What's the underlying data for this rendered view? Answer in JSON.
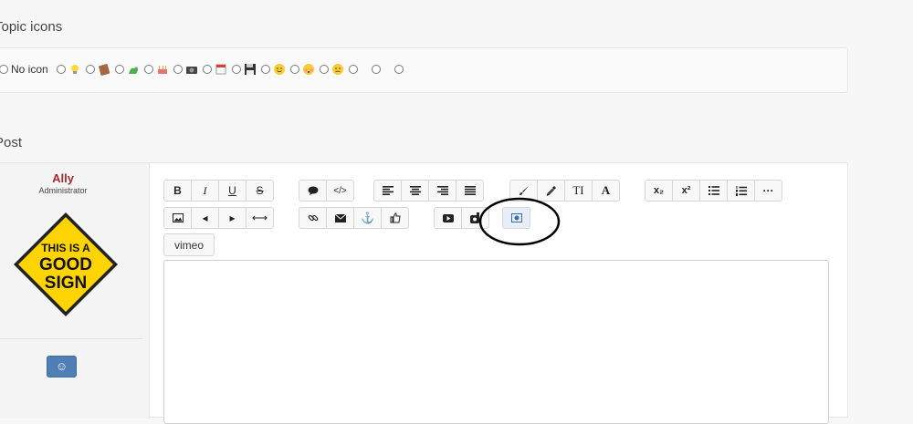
{
  "topic_icons": {
    "title": "Topic icons",
    "no_icon_label": "No icon",
    "options": [
      "lightbulb",
      "book",
      "dragon",
      "birthday-cake",
      "camera",
      "calendar",
      "floppy-disk",
      "smiley",
      "flushed-face",
      "frowning-face",
      "blank",
      "blank",
      "blank"
    ]
  },
  "post": {
    "title": "Post",
    "author": {
      "name": "Ally",
      "role": "Administrator"
    },
    "sign": {
      "line1": "THIS IS A",
      "line2": "GOOD",
      "line3": "SIGN"
    },
    "smiley_button": "☺"
  },
  "toolbar": {
    "row1": {
      "group1": [
        {
          "name": "bold",
          "label": "B"
        },
        {
          "name": "italic",
          "label": "I"
        },
        {
          "name": "underline",
          "label": "U"
        },
        {
          "name": "strikethrough",
          "label": "S"
        }
      ],
      "group2": [
        {
          "name": "quote",
          "icon": "speech-bubble"
        },
        {
          "name": "code",
          "label": "</>"
        }
      ],
      "group3": [
        {
          "name": "align-left",
          "icon": "align-left"
        },
        {
          "name": "align-center",
          "icon": "align-center"
        },
        {
          "name": "align-right",
          "icon": "align-right"
        },
        {
          "name": "align-justify",
          "icon": "align-justify"
        }
      ],
      "group4": [
        {
          "name": "brush",
          "icon": "brush"
        },
        {
          "name": "eyedropper",
          "icon": "eyedropper"
        },
        {
          "name": "font-size",
          "label": "TI"
        },
        {
          "name": "font-color",
          "label": "A"
        }
      ],
      "group5": [
        {
          "name": "subscript",
          "label": "x₂"
        },
        {
          "name": "superscript",
          "label": "x²"
        },
        {
          "name": "bullet-list",
          "icon": "list-ul"
        },
        {
          "name": "numbered-list",
          "icon": "list-ol"
        },
        {
          "name": "more",
          "label": "···"
        }
      ]
    },
    "row2": {
      "group1": [
        {
          "name": "image",
          "icon": "image"
        },
        {
          "name": "prev",
          "label": "◂"
        },
        {
          "name": "next",
          "label": "▸"
        },
        {
          "name": "horizontal-rule",
          "label": "⟷"
        }
      ],
      "group2": [
        {
          "name": "link",
          "icon": "link"
        },
        {
          "name": "email",
          "icon": "envelope"
        },
        {
          "name": "anchor",
          "label": "⚓"
        },
        {
          "name": "thumbs-up",
          "icon": "thumbs-up"
        }
      ],
      "group3": [
        {
          "name": "youtube",
          "icon": "play"
        },
        {
          "name": "dailymotion",
          "icon": "d"
        }
      ],
      "group4": [
        {
          "name": "screenshot",
          "icon": "camera-box"
        }
      ]
    },
    "vimeo_label": "vimeo"
  },
  "colors": {
    "accent": "#4f7fb5",
    "username": "#a52a2a",
    "sign_yellow": "#ffd400"
  }
}
